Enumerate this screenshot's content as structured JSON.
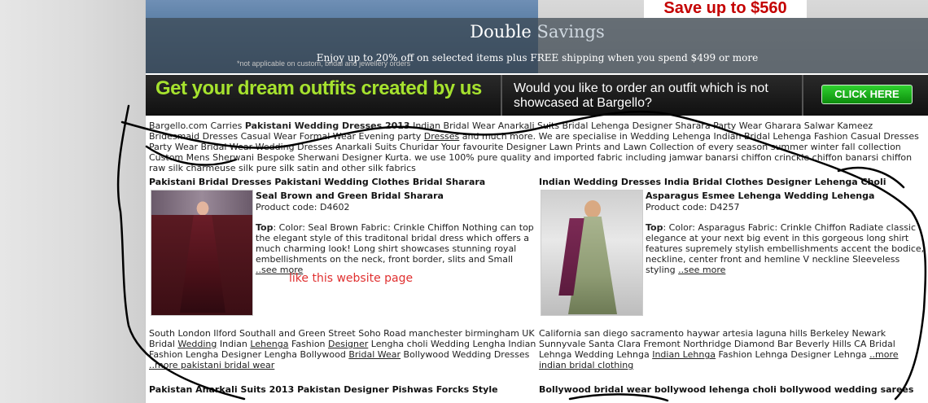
{
  "banner": {
    "save_text": "Save up to $560",
    "headline_part1": "Double",
    "headline_part2": " Savings",
    "offer_text": "Enjoy up to 20% off on selected items plus FREE shipping when you spend $499 or more",
    "disclaimer": "*not applicable on custom, bridal and jewellery orders"
  },
  "darkbar": {
    "dream_text": "Get your dream outfits created by us",
    "question_text": "Would you like to order an outfit which is not showcased at Bargello?",
    "click_label": "CLICK HERE"
  },
  "intro": {
    "seg1": "Bargello.com Carries ",
    "bold1": "Pakistani Wedding Dresses 2013",
    "seg2": " Indian Bridal Wear Anarkali Suits Bridal Lehenga Designer Sharara Party Wear Gharara Salwar Kameez Bridesmaid Dresses Casual Wear Formal Wear Evening party ",
    "link1": "Dresses",
    "seg3": " and much more. We are specialise in Wedding Lehenga Indian Bridal Lehenga Fashion Casual Dresses Party Wear Bridal Wear Wedding Dresses Anarkali Suits Churidar Your favourite Designer Lawn Prints and Lawn Collection of every season summer winter fall collection Custom Mens Sherwani Bespoke Sherwani Designer Kurta. we use 100% pure quality and imported fabric including jamwar banarsi chiffon crinckle chiffon banarsi chiffon raw silk charmeuse silk pure silk satin and other silk fabrics"
  },
  "left_section": {
    "title": "Pakistani Bridal Dresses Pakistani Wedding Clothes Bridal Sharara",
    "product_name": "Seal Brown and Green Bridal Sharara",
    "product_code": "Product code: D4602",
    "desc_label": "Top",
    "desc_text": ": Color: Seal Brown Fabric: Crinkle Chiffon Nothing can top the elegant style of this traditonal bridal dress which offers a much charming look! Long shirt showcases stunning royal embellishments on the neck, front border, slits and Small ",
    "see_more": "..see more"
  },
  "right_section": {
    "title": "Indian Wedding Dresses India Bridal Clothes Designer Lehenga Choli",
    "product_name": "Asparagus Esmee Lehenga Wedding Lehenga",
    "product_code": "Product code: D4257",
    "desc_label": "Top",
    "desc_text": ": Color: Asparagus Fabric: Crinkle Chiffon Radiate classic elegance at your next big event in this gorgeous long shirt features supremely stylish embellishments accent the bodice, neckline, center front and hemline V neckline Sleeveless styling ",
    "see_more": "..see more"
  },
  "annotation": "like this website page",
  "left_footer": {
    "seg1": "South London Ilford Southall and Green Street Soho Road manchester birmingham UK Bridal ",
    "link1": "Wedding",
    "seg2": " Indian ",
    "link2": "Lehenga",
    "seg3": " Fashion ",
    "link3": "Designer",
    "seg4": " Lengha choli Wedding Lengha Indian Fashion Lengha Designer Lengha Bollywood ",
    "link4": "Bridal Wear",
    "seg5": " Bollywood Wedding Dresses ",
    "link5": "..more pakistani bridal wear"
  },
  "right_footer": {
    "seg1": "California san diego sacramento haywar artesia laguna hills Berkeley Newark Sunnyvale Santa Clara Fremont Northridge Diamond Bar Beverly Hills CA Bridal Lehnga Wedding Lehnga ",
    "link1": "Indian Lehnga",
    "seg2": " Fashion Lehnga Designer Lehnga ",
    "link2": "..more indian bridal clothing"
  },
  "bottom_titles": {
    "left": "Pakistan Anarkali Suits 2013 Pakistan Designer Pishwas Forcks Style",
    "right": "Bollywood bridal wear bollywood lehenga choli bollywood wedding sarees"
  }
}
